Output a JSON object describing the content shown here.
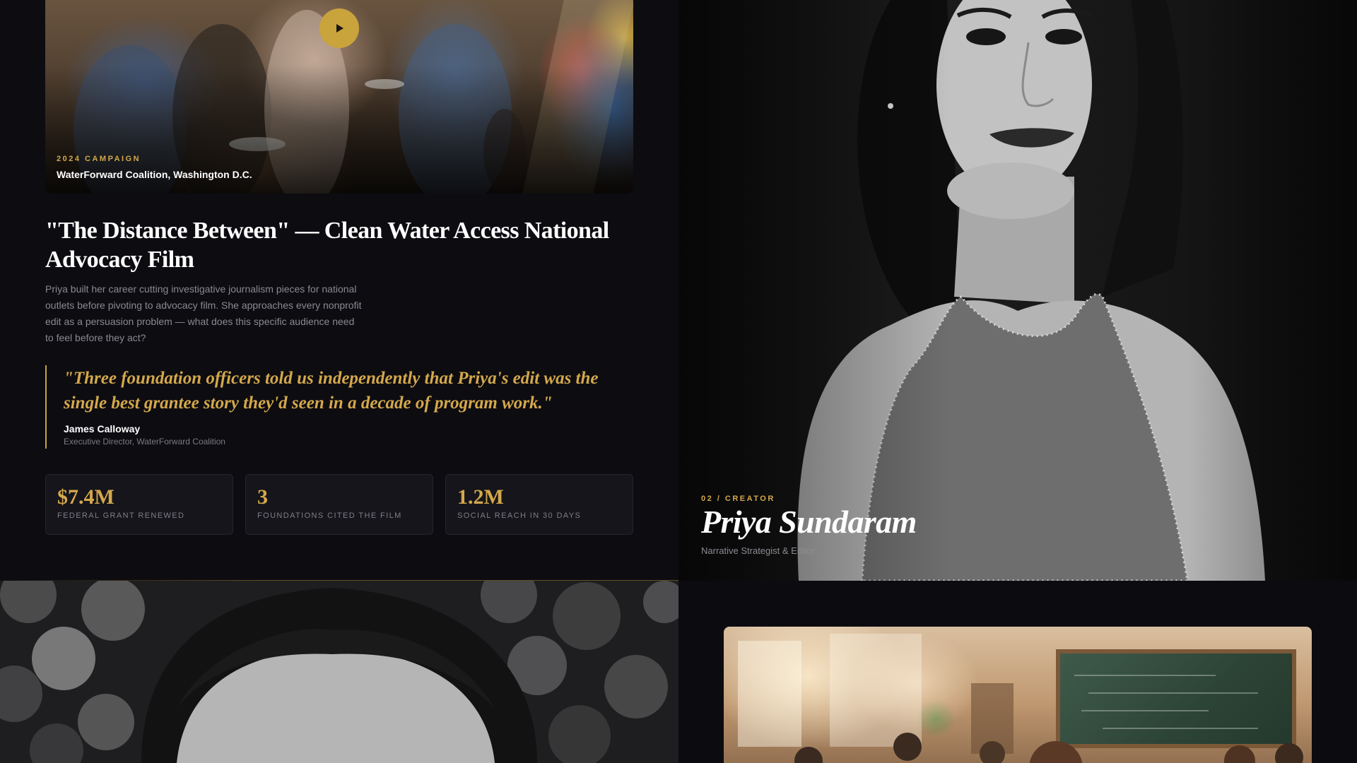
{
  "project": {
    "video_eyebrow": "2024 CAMPAIGN",
    "video_caption": "WaterForward Coalition, Washington D.C.",
    "title": "\"The Distance Between\" — Clean Water Access National Advocacy Film",
    "body": "Priya built her career cutting investigative journalism pieces for national outlets before pivoting to advocacy film. She approaches every nonprofit edit as a persuasion problem — what does this specific audience need to feel before they act?",
    "quote": "\"Three foundation officers told us independently that Priya's edit was the single best grantee story they'd seen in a decade of program work.\"",
    "quote_author": "James Calloway",
    "quote_role": "Executive Director, WaterForward Coalition",
    "stats": [
      {
        "value": "$7.4M",
        "label": "FEDERAL GRANT RENEWED"
      },
      {
        "value": "3",
        "label": "FOUNDATIONS CITED THE FILM"
      },
      {
        "value": "1.2M",
        "label": "SOCIAL REACH IN 30 DAYS"
      }
    ]
  },
  "creator": {
    "eyebrow": "02 / CREATOR",
    "name": "Priya Sundaram",
    "role": "Narrative Strategist & Editor"
  },
  "icons": {
    "play": "play-icon"
  },
  "colors": {
    "accent": "#c9a43c",
    "accent_text": "#d4a84b",
    "background": "#0d0c11",
    "card": "#16151b"
  }
}
